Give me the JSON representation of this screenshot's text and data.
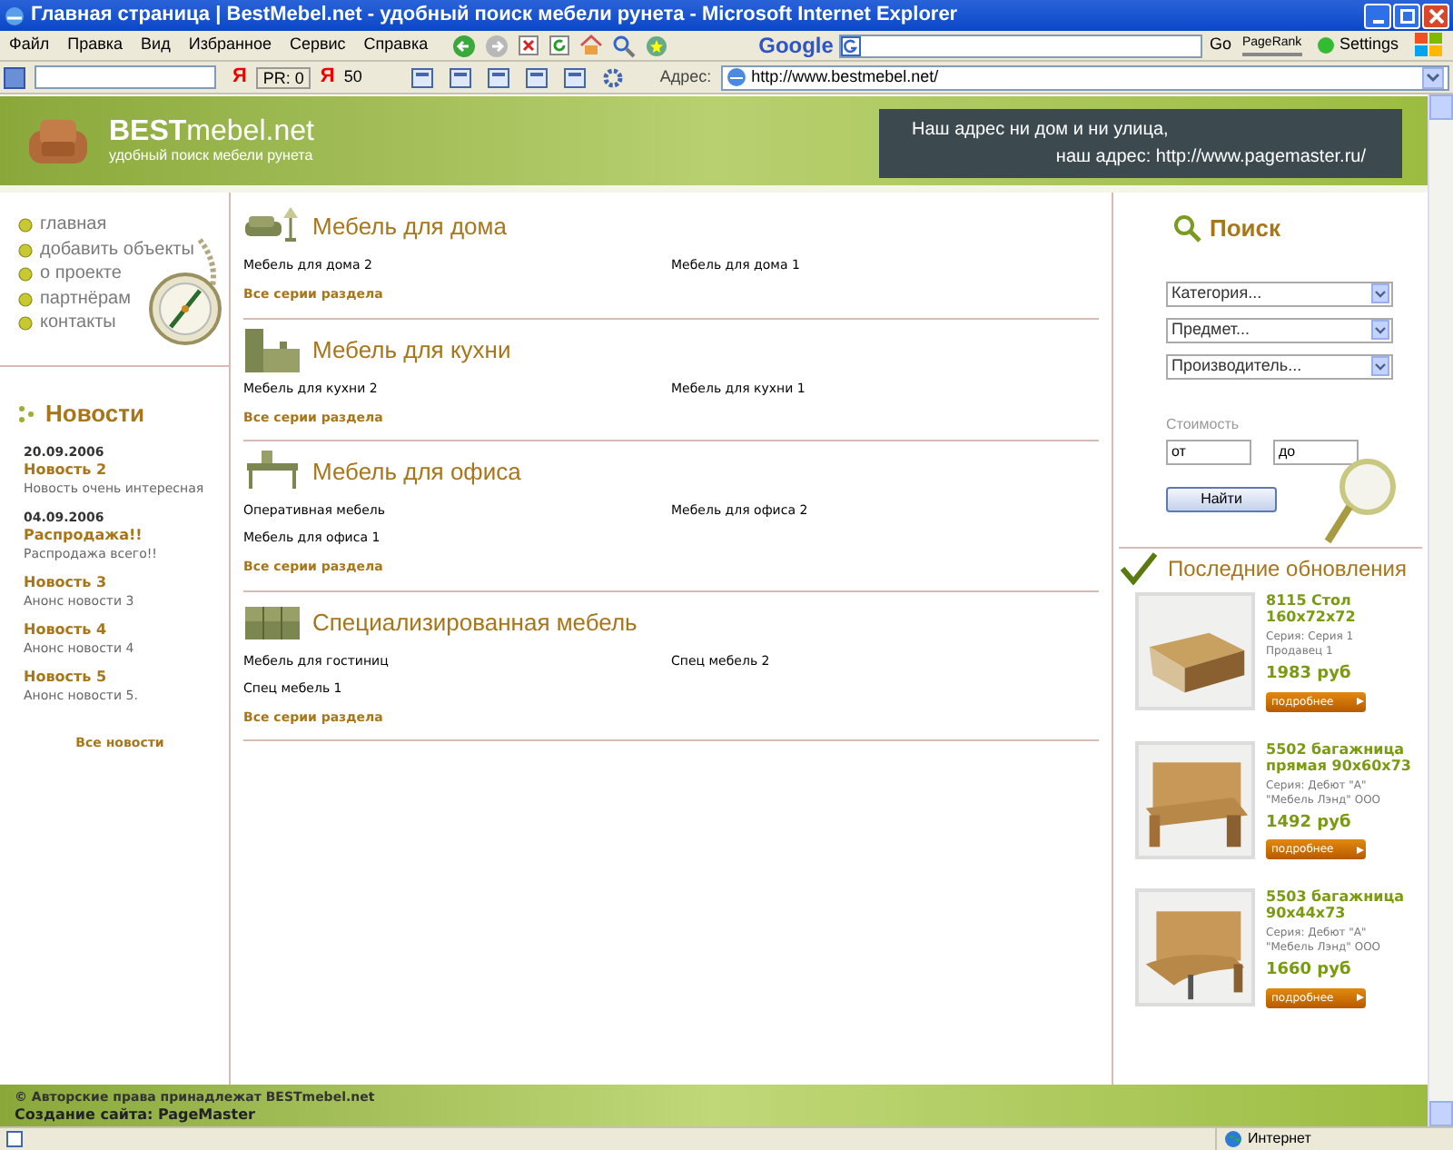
{
  "window": {
    "title": "Главная страница | BestMebel.net - удобный поиск мебели рунета - Microsoft Internet Explorer"
  },
  "menu": [
    "Файл",
    "Правка",
    "Вид",
    "Избранное",
    "Сервис",
    "Справка"
  ],
  "google_bar": {
    "logo": "Google",
    "go": "Go",
    "pagerank": "PageRank",
    "settings": "Settings"
  },
  "yandex_bar": {
    "mark_1": "Я",
    "pr": "PR: 0",
    "mark_2": "Я",
    "count": "50"
  },
  "address_bar": {
    "label": "Адрес:",
    "value": "http://www.bestmebel.net/"
  },
  "page": {
    "logo": {
      "brand": "**BEST**mebel.net",
      "tagline": "удобный поиск мебели рунета"
    },
    "address_box": [
      "Наш адрес ни дом и ни улица,",
      "наш адрес: http://www.pagemaster.ru/"
    ],
    "nav": [
      "главная",
      "добавить объекты",
      "о проекте",
      "партнёрам",
      "контакты"
    ],
    "news": {
      "title": "Новости",
      "items": [
        {
          "date": "20.09.2006",
          "title": "Новость 2",
          "text": "Новость очень интересная"
        },
        {
          "date": "04.09.2006",
          "title": "Распродажа!!",
          "text": "Распродажа всего!!"
        },
        {
          "title": "Новость 3",
          "text": "Анонс новости 3"
        },
        {
          "title": "Новость 4",
          "text": "Анонс новости 4"
        },
        {
          "title": "Новость 5",
          "text": "Анонс новости 5."
        }
      ],
      "all_link": "Все новости"
    },
    "sections": [
      {
        "kind": "home",
        "title": "Мебель для дома",
        "items": [
          "Мебель для дома 2",
          "Мебель для дома 1"
        ],
        "link": "Все серии раздела"
      },
      {
        "kind": "kitchen",
        "title": "Мебель для кухни",
        "items": [
          "Мебель для кухни 2",
          "Мебель для кухни 1"
        ],
        "link": "Все серии раздела"
      },
      {
        "kind": "office",
        "title": "Мебель для офиса",
        "items": [
          "Оперативная мебель",
          "Мебель для офиса 2",
          "Мебель для офиса 1"
        ],
        "link": "Все серии раздела"
      },
      {
        "kind": "special",
        "title": "Специализированная мебель",
        "items": [
          "Мебель для гостиниц",
          "Спец мебель 2",
          "Спец мебель 1"
        ],
        "link": "Все серии раздела"
      }
    ],
    "search": {
      "title": "Поиск",
      "selects": [
        "Категория...",
        "Предмет...",
        "Производитель..."
      ],
      "cost_label": "Стоимость",
      "from": "от",
      "to": "до",
      "button": "Найти"
    },
    "updates": {
      "title": "Последние обновления",
      "products": [
        {
          "kind": "desk",
          "name": "8115 Стол 160x72x72",
          "details": [
            "Серия: Серия 1",
            "Продавец 1"
          ],
          "price": "1983 руб",
          "button": "подробнее"
        },
        {
          "kind": "desk-wall",
          "name": "5502 багажница прямая 90x60x73",
          "details": [
            "Серия: Дебют \"А\"",
            "\"Мебель Лэнд\" ООО"
          ],
          "price": "1492 руб",
          "button": "подробнее"
        },
        {
          "kind": "desk-round",
          "name": "5503 багажница 90x44x73",
          "details": [
            "Серия: Дебют \"А\"",
            "\"Мебель Лэнд\" ООО"
          ],
          "price": "1660 руб",
          "button": "подробнее"
        }
      ]
    },
    "footer": [
      "© Авторские права принадлежат BESTmebel.net",
      "Создание сайта: PageMaster"
    ]
  },
  "status_bar": {
    "zone": "Интернет"
  }
}
